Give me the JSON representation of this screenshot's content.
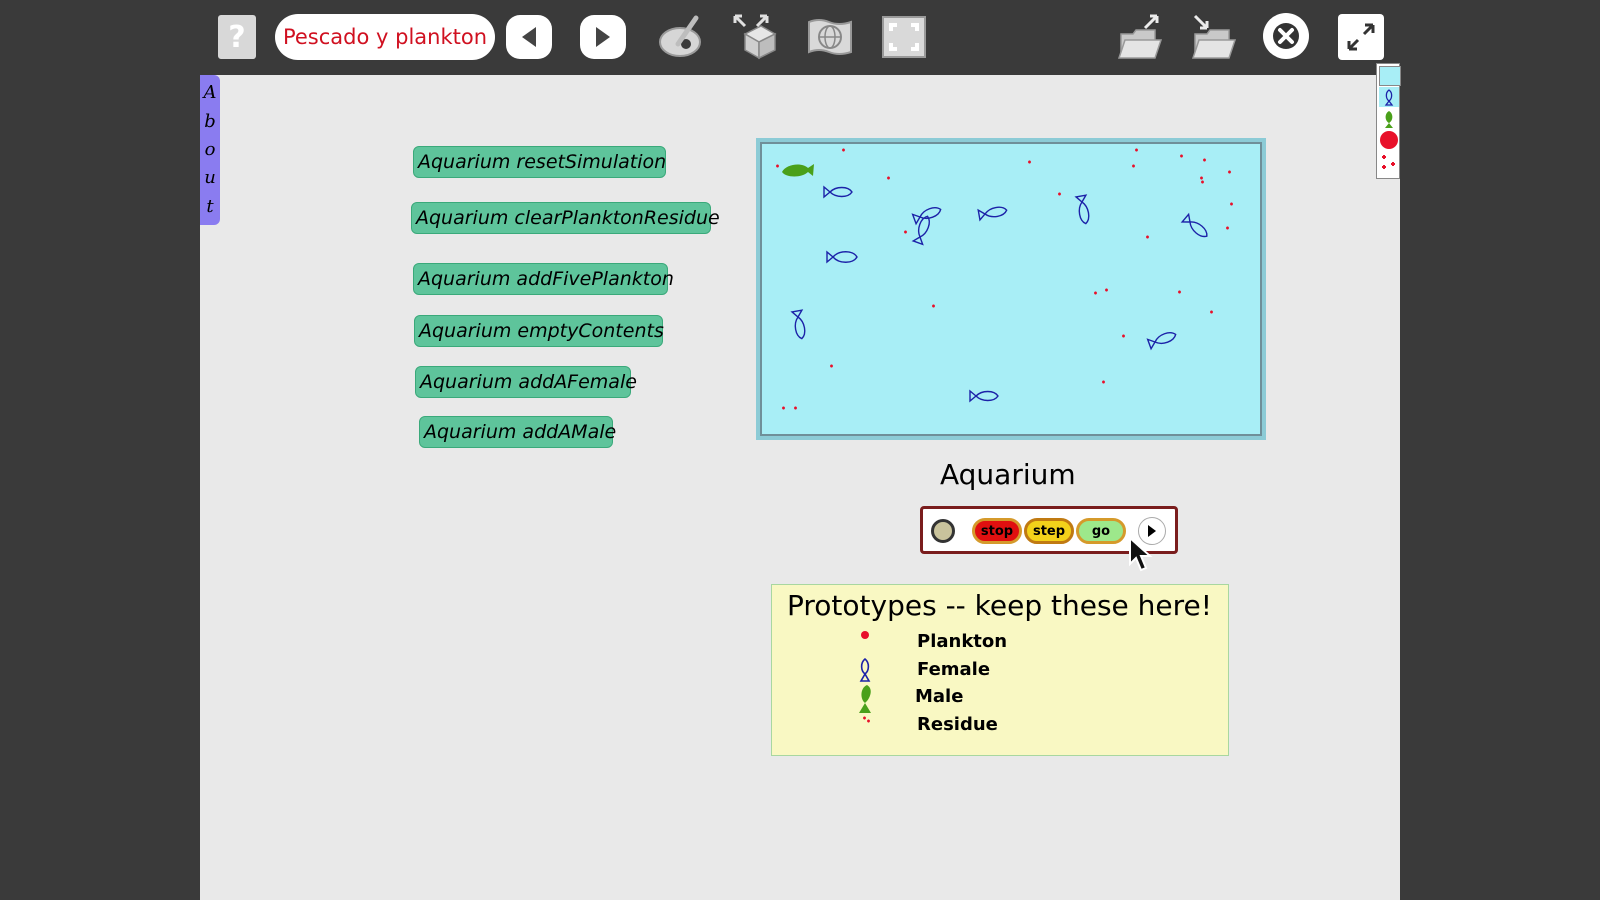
{
  "toolbar": {
    "help_label": "?",
    "project_name": "Pescado y plankton",
    "icons": [
      "help-icon",
      "back-arrow-icon",
      "forward-arrow-icon",
      "paint-icon",
      "supplies-icon",
      "world-icon",
      "fullscreen-frame-icon",
      "open-project-icon",
      "import-project-icon",
      "close-icon",
      "expand-icon"
    ]
  },
  "about_tab": {
    "letters": [
      "A",
      "b",
      "o",
      "u",
      "t"
    ]
  },
  "script_buttons": [
    {
      "label": "Aquarium resetSimulation"
    },
    {
      "label": "Aquarium clearPlanktonResidue"
    },
    {
      "label": "Aquarium addFivePlankton"
    },
    {
      "label": "Aquarium emptyContents"
    },
    {
      "label": "Aquarium addAFemale"
    },
    {
      "label": "Aquarium addAMale"
    }
  ],
  "aquarium": {
    "label": "Aquarium",
    "water_color": "#a8eef6"
  },
  "controls": {
    "stop": "stop",
    "step": "step",
    "go": "go"
  },
  "prototypes": {
    "title": "Prototypes -- keep these here!",
    "items": [
      {
        "label": "Plankton",
        "icon": "plankton-icon"
      },
      {
        "label": "Female",
        "icon": "female-fish-icon"
      },
      {
        "label": "Male",
        "icon": "male-fish-icon"
      },
      {
        "label": "Residue",
        "icon": "residue-icon"
      }
    ]
  },
  "colors": {
    "accent_red": "#d01020",
    "button_green": "#5ec49b",
    "about_purple": "#8a7cf0",
    "fish_blue": "#1c22a8",
    "male_green": "#4aa01a"
  }
}
